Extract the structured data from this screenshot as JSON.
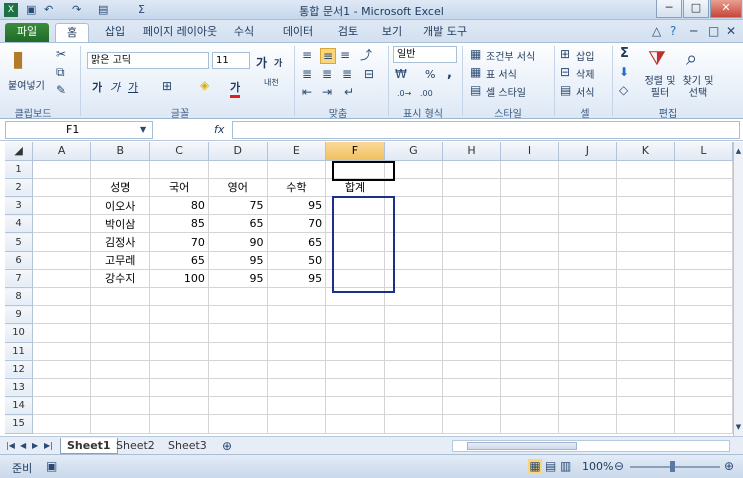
{
  "window": {
    "title": "통합 문서1 - Microsoft Excel",
    "controls": [
      "─",
      "□",
      "✕"
    ]
  },
  "ribbon_tabs": [
    "파일",
    "홈",
    "삽입",
    "페이지 레이아웃",
    "수식",
    "데이터",
    "검토",
    "보기",
    "개발 도구"
  ],
  "clipboard": {
    "paste": "붙여넣기",
    "group": "클립보드"
  },
  "font": {
    "name": "맑은 고딕",
    "size": "11",
    "group": "글꼴",
    "bold": "가",
    "italic": "가",
    "underline": "가",
    "grow": "가",
    "shrink": "가",
    "phonetic": "내천"
  },
  "alignment": {
    "group": "맞춤"
  },
  "number": {
    "format": "일반",
    "group": "표시 형식",
    "percent": "%",
    "comma": ","
  },
  "styles": {
    "conditional": "조건부 서식",
    "table": "표 서식",
    "cell": "셀 스타일",
    "group": "스타일"
  },
  "cells": {
    "insert": "삽입",
    "delete": "삭제",
    "format": "서식",
    "group": "셀"
  },
  "editing": {
    "sort": "정렬 및 필터",
    "find": "찾기 및 선택",
    "group": "편집",
    "sigma": "Σ"
  },
  "formula_bar": {
    "name_box": "F1",
    "fx": "fx",
    "value": ""
  },
  "columns": [
    "A",
    "B",
    "C",
    "D",
    "E",
    "F",
    "G",
    "H",
    "I",
    "J",
    "K",
    "L"
  ],
  "rows": [
    [
      "",
      "",
      "",
      "",
      "",
      "",
      "",
      "",
      "",
      "",
      "",
      ""
    ],
    [
      "",
      "성명",
      "국어",
      "영어",
      "수학",
      "합계",
      "",
      "",
      "",
      "",
      "",
      ""
    ],
    [
      "",
      "이오사",
      "80",
      "75",
      "95",
      "",
      "",
      "",
      "",
      "",
      "",
      ""
    ],
    [
      "",
      "박이삼",
      "85",
      "65",
      "70",
      "",
      "",
      "",
      "",
      "",
      "",
      ""
    ],
    [
      "",
      "김정사",
      "70",
      "90",
      "65",
      "",
      "",
      "",
      "",
      "",
      "",
      ""
    ],
    [
      "",
      "고무레",
      "65",
      "95",
      "50",
      "",
      "",
      "",
      "",
      "",
      "",
      ""
    ],
    [
      "",
      "강수지",
      "100",
      "95",
      "95",
      "",
      "",
      "",
      "",
      "",
      "",
      ""
    ],
    [
      "",
      "",
      "",
      "",
      "",
      "",
      "",
      "",
      "",
      "",
      "",
      ""
    ],
    [
      "",
      "",
      "",
      "",
      "",
      "",
      "",
      "",
      "",
      "",
      "",
      ""
    ],
    [
      "",
      "",
      "",
      "",
      "",
      "",
      "",
      "",
      "",
      "",
      "",
      ""
    ],
    [
      "",
      "",
      "",
      "",
      "",
      "",
      "",
      "",
      "",
      "",
      "",
      ""
    ],
    [
      "",
      "",
      "",
      "",
      "",
      "",
      "",
      "",
      "",
      "",
      "",
      ""
    ],
    [
      "",
      "",
      "",
      "",
      "",
      "",
      "",
      "",
      "",
      "",
      "",
      ""
    ],
    [
      "",
      "",
      "",
      "",
      "",
      "",
      "",
      "",
      "",
      "",
      "",
      ""
    ],
    [
      "",
      "",
      "",
      "",
      "",
      "",
      "",
      "",
      "",
      "",
      "",
      ""
    ]
  ],
  "sheets": [
    "Sheet1",
    "Sheet2",
    "Sheet3"
  ],
  "status": {
    "mode": "준비",
    "zoom": "100%"
  }
}
